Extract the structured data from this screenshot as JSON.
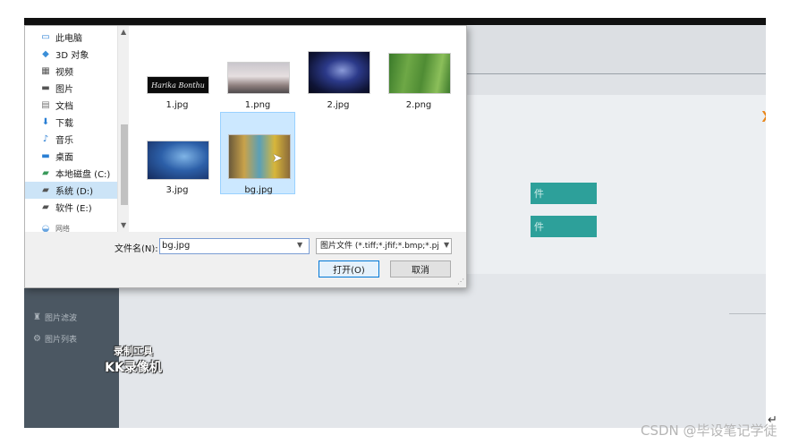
{
  "app": {
    "sidebar_items": [
      {
        "icon": "filter-icon",
        "label": "图片滤波"
      },
      {
        "icon": "gear-icon",
        "label": "图片列表"
      }
    ],
    "teal_buttons": [
      {
        "label": "件"
      },
      {
        "label": "件"
      }
    ]
  },
  "dialog": {
    "nav_items": [
      {
        "icon": "computer-icon",
        "label": "此电脑",
        "selected": false
      },
      {
        "icon": "3d-objects-icon",
        "label": "3D 对象",
        "selected": false
      },
      {
        "icon": "video-icon",
        "label": "视频",
        "selected": false
      },
      {
        "icon": "pictures-icon",
        "label": "图片",
        "selected": false
      },
      {
        "icon": "documents-icon",
        "label": "文档",
        "selected": false
      },
      {
        "icon": "download-icon",
        "label": "下载",
        "selected": false
      },
      {
        "icon": "music-icon",
        "label": "音乐",
        "selected": false
      },
      {
        "icon": "desktop-icon",
        "label": "桌面",
        "selected": false
      },
      {
        "icon": "drive-icon",
        "label": "本地磁盘 (C:)",
        "selected": false
      },
      {
        "icon": "drive-icon",
        "label": "系统 (D:)",
        "selected": true
      },
      {
        "icon": "drive-icon",
        "label": "软件 (E:)",
        "selected": false
      },
      {
        "icon": "network-icon",
        "label": "网络",
        "selected": false
      }
    ],
    "files": [
      {
        "name": "1.jpg",
        "selected": false,
        "thumb": "text-banner"
      },
      {
        "name": "1.png",
        "selected": false,
        "thumb": "clouds"
      },
      {
        "name": "2.jpg",
        "selected": false,
        "thumb": "galaxy"
      },
      {
        "name": "2.png",
        "selected": false,
        "thumb": "grass"
      },
      {
        "name": "3.jpg",
        "selected": false,
        "thumb": "blue-abstract"
      },
      {
        "name": "bg.jpg",
        "selected": true,
        "thumb": "canal"
      }
    ],
    "thumb_text": "Harika Bonthu",
    "filename_label": "文件名(N):",
    "filename_value": "bg.jpg",
    "filter_value": "图片文件 (*.tiff;*.jfif;*.bmp;*.pj",
    "open_label": "打开(O)",
    "cancel_label": "取消"
  },
  "watermark": {
    "line1": "录制工具",
    "line2": "KK录像机"
  },
  "footer": {
    "credit": "CSDN @毕设笔记学徒",
    "return_glyph": "↵"
  },
  "colors": {
    "accent": "#0078d7",
    "teal": "#2da09a",
    "sidebar": "#4b5762",
    "selection": "#cce8ff"
  }
}
